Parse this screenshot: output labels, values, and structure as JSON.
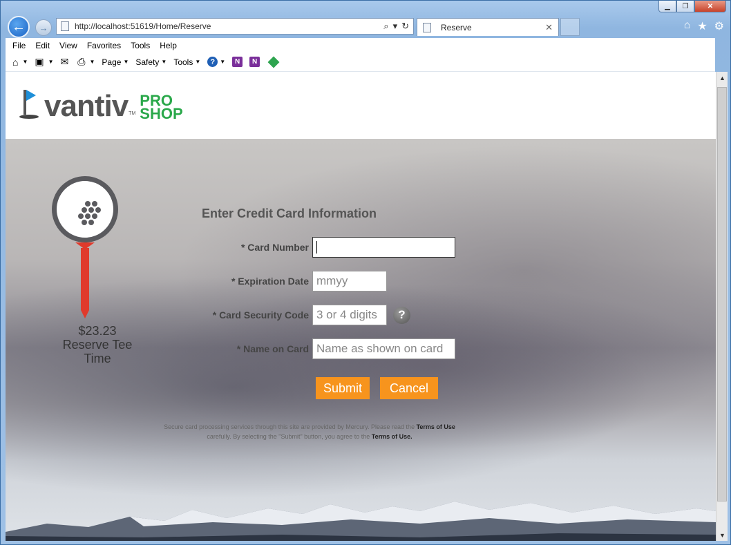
{
  "browser": {
    "address": "http://localhost:51619/Home/Reserve",
    "tab_title": "Reserve",
    "menu": [
      "File",
      "Edit",
      "View",
      "Favorites",
      "Tools",
      "Help"
    ],
    "commands": {
      "page": "Page",
      "safety": "Safety",
      "tools": "Tools"
    },
    "icons": [
      "home-icon",
      "feeds-icon",
      "mail-icon",
      "print-icon",
      "help-icon",
      "onenote-icon",
      "onenote-linked-icon",
      "green-diamond-icon",
      "favorites-star-icon",
      "settings-gear-icon"
    ]
  },
  "header": {
    "brand": "vantiv",
    "brand_tm": "TM",
    "pro": "PRO",
    "shop": "SHOP"
  },
  "reservation": {
    "price": "$23.23",
    "description_line1": "Reserve Tee",
    "description_line2": "Time"
  },
  "form": {
    "title": "Enter Credit Card Information",
    "card_number_label": "* Card Number",
    "card_number_value": "",
    "expiration_label": "* Expiration Date",
    "expiration_placeholder": "mmyy",
    "security_label": "* Card Security Code",
    "security_placeholder": "3 or 4 digits",
    "name_label": "* Name on Card",
    "name_placeholder": "Name as shown on card",
    "submit": "Submit",
    "cancel": "Cancel",
    "disclaimer_part1": "Secure card processing services through this site are provided by Mercury. Please read the ",
    "terms_link_1": "Terms of Use",
    "disclaimer_part2": " carefully. By selecting the \"Submit\" button, you agree to the ",
    "terms_link_2": "Terms of Use."
  },
  "colors": {
    "accent_orange": "#f7941d",
    "brand_green": "#2aa84a",
    "tee_red": "#e03a2c",
    "flag_blue": "#1e8fd8"
  }
}
